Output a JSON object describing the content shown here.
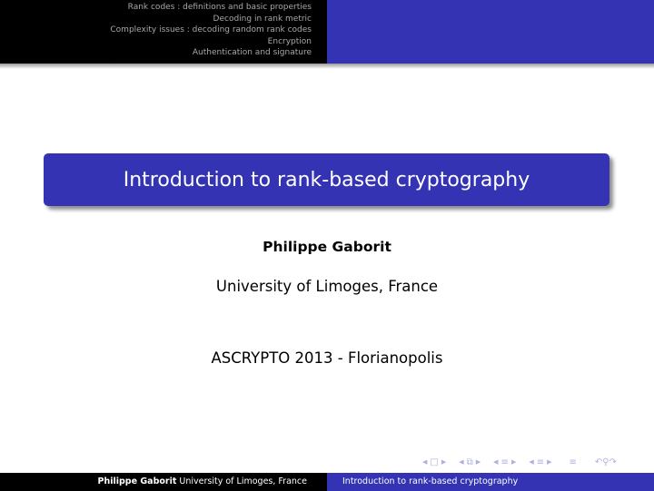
{
  "header": {
    "toc": [
      "Rank codes : definitions and basic properties",
      "Decoding in rank metric",
      "Complexity issues : decoding random rank codes",
      "Encryption",
      "Authentication and signature"
    ]
  },
  "title": "Introduction to rank-based cryptography",
  "author": "Philippe Gaborit",
  "institution": "University of Limoges, France",
  "event": "ASCRYPTO 2013 - Florianopolis",
  "nav_icons": [
    "frame-nav-icon",
    "slide-nav-icon",
    "section-nav-icon",
    "subsection-nav-icon",
    "align-icon",
    "undo-search-redo-icon"
  ],
  "footer": {
    "author": "Philippe Gaborit",
    "institution": "University of Limoges, France",
    "title": "Introduction to rank-based cryptography"
  },
  "colors": {
    "accent": "#3333b3",
    "header_dark": "#000000",
    "nav_icons": "#b0b0e0"
  }
}
